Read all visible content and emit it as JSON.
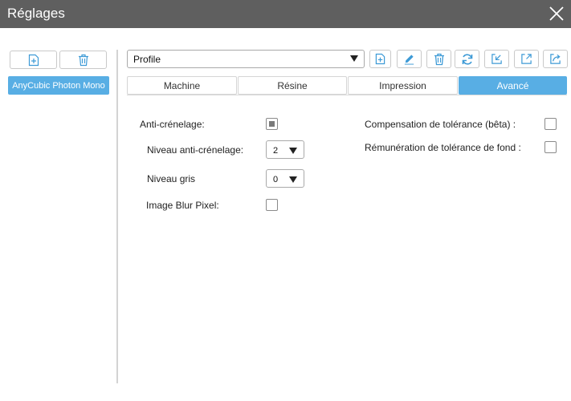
{
  "window": {
    "title": "Réglages"
  },
  "sidebar": {
    "printers": [
      {
        "label": "AnyCubic Photon Mono"
      }
    ]
  },
  "profile": {
    "selected": "Profile"
  },
  "tabs": [
    {
      "label": "Machine",
      "active": false
    },
    {
      "label": "Résine",
      "active": false
    },
    {
      "label": "Impression",
      "active": false
    },
    {
      "label": "Avancé",
      "active": true
    }
  ],
  "settings": {
    "anti_aliasing": {
      "label": "Anti-crénelage:",
      "checked": true
    },
    "anti_aliasing_level": {
      "label": "Niveau anti-crénelage:",
      "value": "2"
    },
    "gray_level": {
      "label": "Niveau gris",
      "value": "0"
    },
    "image_blur": {
      "label": "Image Blur Pixel:",
      "checked": false
    },
    "tolerance_compensation": {
      "label": "Compensation de tolérance (bêta) :",
      "checked": false
    },
    "bottom_tolerance": {
      "label": "Rémunération de tolérance de fond :",
      "checked": false
    }
  },
  "colors": {
    "accent": "#58aee4",
    "titlebar": "#5f5f5f"
  },
  "icons": [
    "close-icon",
    "add-file-icon",
    "trash-icon",
    "edit-icon",
    "refresh-icon",
    "import-icon",
    "export-icon",
    "share-icon",
    "dropdown-arrow-icon"
  ]
}
